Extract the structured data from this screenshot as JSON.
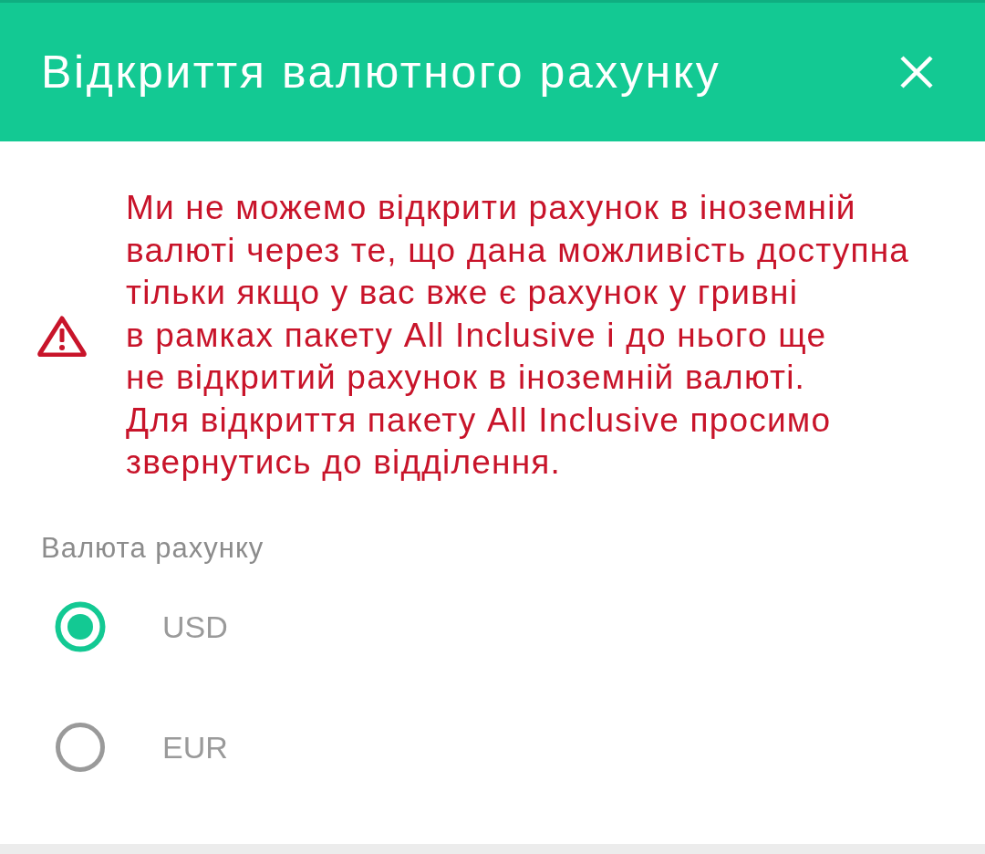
{
  "dialog": {
    "title": "Відкриття валютного рахунку"
  },
  "warning": {
    "message": "Ми не можемо відкрити рахунок в іноземній\nвалюті через те, що дана можливість доступна\nтільки якщо у вас вже є рахунок у гривні\nв рамках пакету All Inclusive і до нього ще\nне відкритий рахунок в іноземній валюті.\nДля відкриття пакету All Inclusive просимо\nзвернутись до відділення."
  },
  "currency": {
    "label": "Валюта рахунку",
    "options": [
      {
        "label": "USD",
        "selected": true
      },
      {
        "label": "EUR",
        "selected": false
      }
    ]
  }
}
